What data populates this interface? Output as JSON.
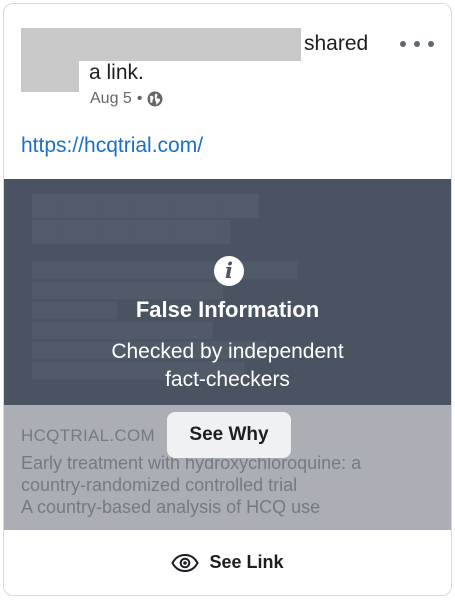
{
  "post": {
    "shared_label": "shared",
    "link_label": "a link.",
    "date": "Aug 5",
    "separator": "•",
    "audience_icon": "globe-icon",
    "more_icon": "more-options-icon",
    "url": "https://hcqtrial.com/"
  },
  "preview": {
    "domain": "HCQTRIAL.COM",
    "description_lines": [
      "Early treatment with hydroxychloroquine: a",
      "country-randomized controlled trial",
      "A country-based analysis of HCQ use"
    ]
  },
  "fact_check": {
    "info_icon": "info-icon",
    "title": "False Information",
    "subtitle_line1": "Checked by independent",
    "subtitle_line2": "fact-checkers",
    "button_label": "See Why"
  },
  "footer": {
    "eye_icon": "eye-icon",
    "see_link_label": "See Link"
  },
  "colors": {
    "link": "#1a6fcc",
    "overlay": "#58606c",
    "text_primary": "#1c1e21",
    "text_secondary": "#65676b"
  }
}
